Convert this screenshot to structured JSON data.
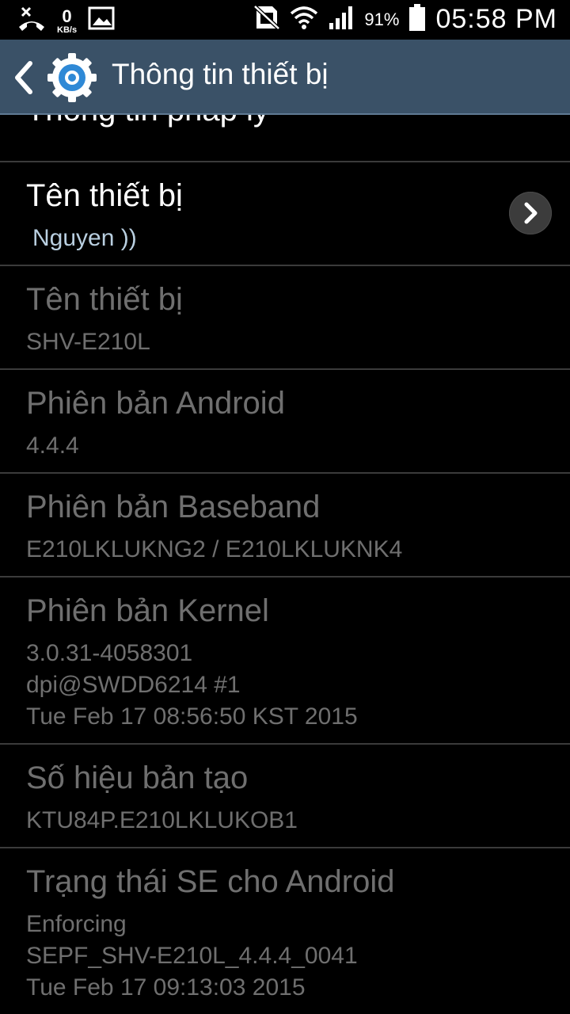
{
  "statusbar": {
    "speed_value": "0",
    "speed_unit": "KB/s",
    "battery_percent": "91%",
    "time": "05:58 PM",
    "icons": [
      "missed-call-icon",
      "image-icon",
      "no-sim-icon",
      "wifi-icon",
      "signal-icon",
      "battery-icon"
    ]
  },
  "actionbar": {
    "title": "Thông tin thiết bị"
  },
  "list": {
    "partial_item_title": "Thông tin pháp lý",
    "items": [
      {
        "title": "Tên thiết bị",
        "lines": [
          "Nguyen ))"
        ],
        "enabled": true
      },
      {
        "title": "Tên thiết bị",
        "lines": [
          "SHV-E210L"
        ],
        "enabled": false
      },
      {
        "title": "Phiên bản Android",
        "lines": [
          "4.4.4"
        ],
        "enabled": false
      },
      {
        "title": "Phiên bản Baseband",
        "lines": [
          "E210LKLUKNG2 / E210LKLUKNK4"
        ],
        "enabled": false
      },
      {
        "title": "Phiên bản Kernel",
        "lines": [
          "3.0.31-4058301",
          "dpi@SWDD6214 #1",
          "Tue Feb 17 08:56:50 KST 2015"
        ],
        "enabled": false
      },
      {
        "title": "Số hiệu bản tạo",
        "lines": [
          "KTU84P.E210LKLUKOB1"
        ],
        "enabled": false
      },
      {
        "title": "Trạng thái SE cho Android",
        "lines": [
          "Enforcing",
          "SEPF_SHV-E210L_4.4.4_0041",
          "Tue Feb 17 09:13:03 2015"
        ],
        "enabled": false
      }
    ]
  },
  "colors": {
    "actionbar_bg": "#3a5167",
    "enabled_title": "#ffffff",
    "enabled_summary": "#b9cfe0",
    "disabled_text": "#6f6f6f",
    "divider": "#3b3b3b"
  }
}
